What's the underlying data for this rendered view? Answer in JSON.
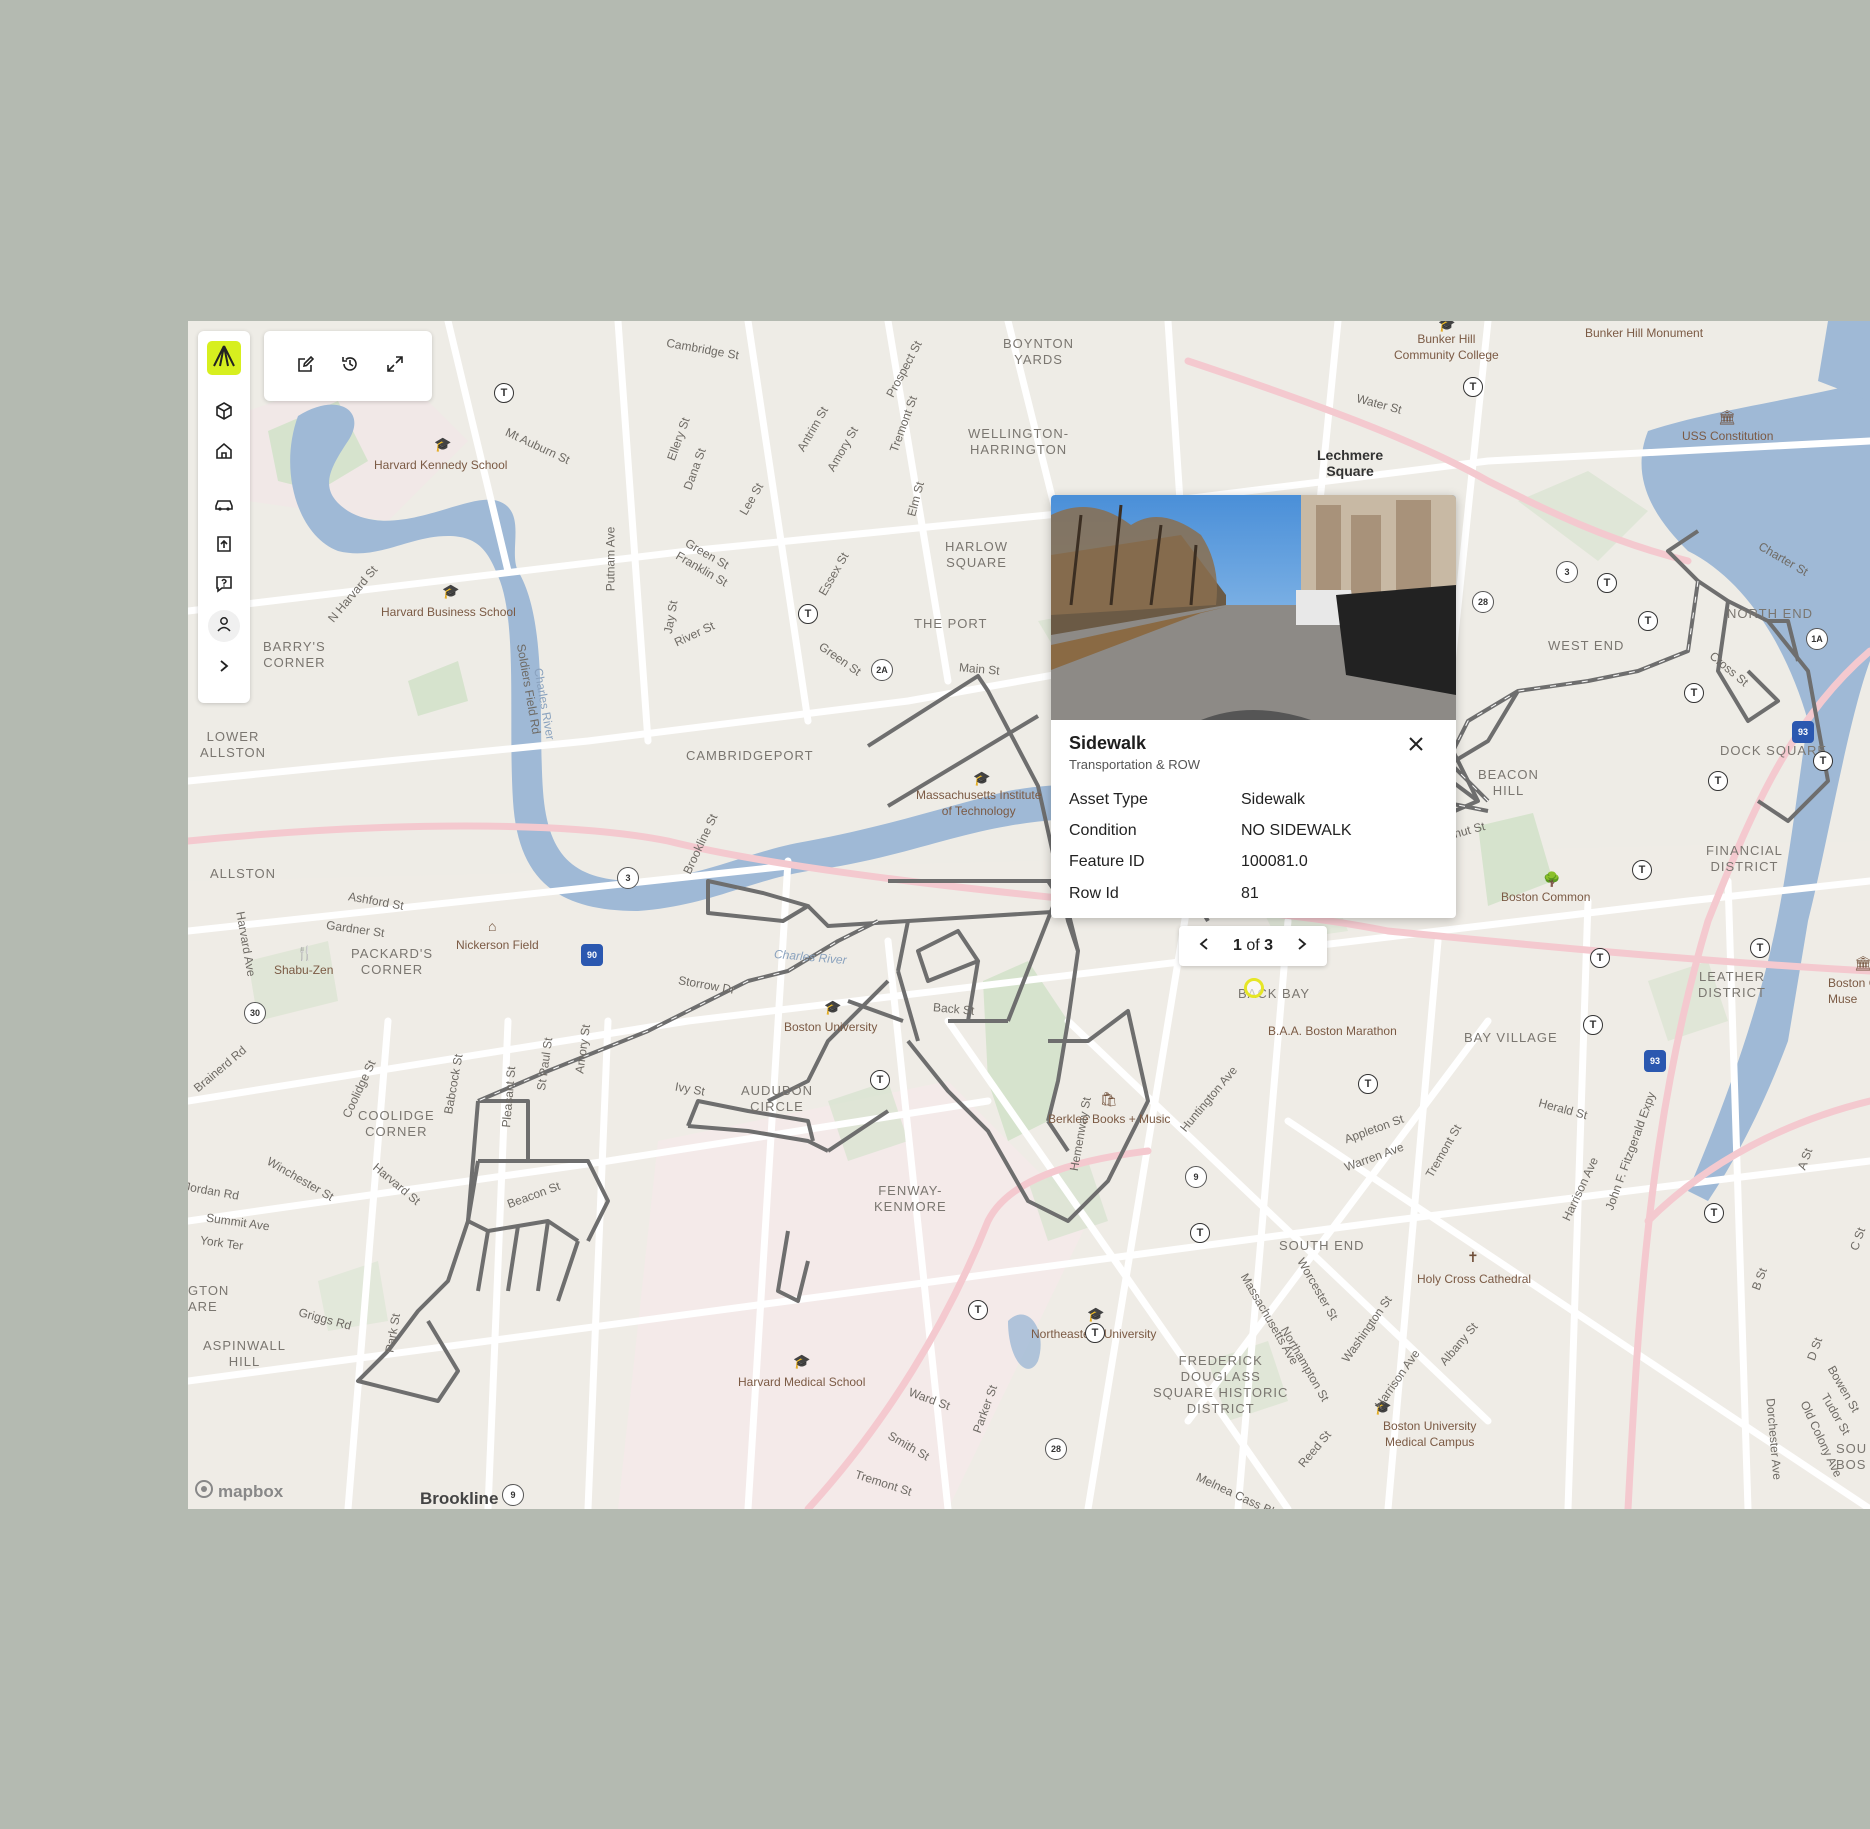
{
  "colors": {
    "accent": "#d7ef1f",
    "background": "#b4bab1",
    "water": "#9fb9d6",
    "park": "#d4e2c9",
    "asset_line": "#6e6e6e",
    "marker": "#e6e626"
  },
  "sidebar": {
    "logo_icon": "brand-logo-icon",
    "items": [
      {
        "name": "layers",
        "icon": "cube-icon"
      },
      {
        "name": "home",
        "icon": "home-icon"
      },
      {
        "name": "vehicle",
        "icon": "car-icon"
      },
      {
        "name": "upload",
        "icon": "upload-icon"
      },
      {
        "name": "feedback",
        "icon": "message-question-icon"
      },
      {
        "name": "account",
        "icon": "user-icon"
      },
      {
        "name": "expand",
        "icon": "chevron-right-icon"
      }
    ]
  },
  "toolbar": {
    "items": [
      {
        "name": "edit",
        "icon": "edit-icon"
      },
      {
        "name": "history",
        "icon": "history-icon"
      },
      {
        "name": "fullscreen",
        "icon": "expand-icon"
      }
    ]
  },
  "popup": {
    "title": "Sidewalk",
    "subtitle": "Transportation & ROW",
    "attributes": [
      {
        "key": "Asset Type",
        "value": "Sidewalk"
      },
      {
        "key": "Condition",
        "value": "NO SIDEWALK"
      },
      {
        "key": "Feature ID",
        "value": "100081.0"
      },
      {
        "key": "Row Id",
        "value": "81"
      }
    ]
  },
  "pager": {
    "current": "1",
    "separator": "of",
    "total": "3"
  },
  "attribution": "mapbox",
  "map": {
    "neighborhoods": [
      {
        "text": "BOYNTON YARDS",
        "lines": [
          "BOYNTON",
          "YARDS"
        ]
      },
      {
        "text": "WELLINGTON-HARRINGTON",
        "lines": [
          "WELLINGTON-",
          "HARRINGTON"
        ]
      },
      {
        "text": "HARLOW SQUARE",
        "lines": [
          "HARLOW",
          "SQUARE"
        ]
      },
      {
        "text": "THE PORT",
        "lines": [
          "THE PORT"
        ]
      },
      {
        "text": "CAMBRIDGEPORT",
        "lines": [
          "CAMBRIDGEPORT"
        ]
      },
      {
        "text": "BARRY'S CORNER",
        "lines": [
          "BARRY'S",
          "CORNER"
        ]
      },
      {
        "text": "LOWER ALLSTON",
        "lines": [
          "LOWER",
          "ALLSTON"
        ]
      },
      {
        "text": "ALLSTON",
        "lines": [
          "ALLSTON"
        ]
      },
      {
        "text": "PACKARD'S CORNER",
        "lines": [
          "PACKARD'S",
          "CORNER"
        ]
      },
      {
        "text": "COOLIDGE CORNER",
        "lines": [
          "COOLIDGE",
          "CORNER"
        ]
      },
      {
        "text": "AUDUBON CIRCLE",
        "lines": [
          "AUDUBON",
          "CIRCLE"
        ]
      },
      {
        "text": "FENWAY-KENMORE",
        "lines": [
          "FENWAY-",
          "KENMORE"
        ]
      },
      {
        "text": "ASPINWALL HILL",
        "lines": [
          "ASPINWALL",
          "HILL"
        ]
      },
      {
        "text": "SOUTH END",
        "lines": [
          "SOUTH END"
        ]
      },
      {
        "text": "FREDERICK DOUGLASS SQUARE HISTORIC DISTRICT",
        "lines": [
          "FREDERICK",
          "DOUGLASS",
          "SQUARE HISTORIC",
          "DISTRICT"
        ]
      },
      {
        "text": "BAY VILLAGE",
        "lines": [
          "BAY VILLAGE"
        ]
      },
      {
        "text": "LEATHER DISTRICT",
        "lines": [
          "LEATHER",
          "DISTRICT"
        ]
      },
      {
        "text": "FINANCIAL DISTRICT",
        "lines": [
          "FINANCIAL",
          "DISTRICT"
        ]
      },
      {
        "text": "BEACON HILL",
        "lines": [
          "BEACON",
          "HILL"
        ]
      },
      {
        "text": "WEST END",
        "lines": [
          "WEST END"
        ]
      },
      {
        "text": "NORTH END",
        "lines": [
          "NORTH END"
        ]
      },
      {
        "text": "DOCK SQUARE",
        "lines": [
          "DOCK SQUARE"
        ]
      },
      {
        "text": "BACK BAY",
        "lines": [
          "BACK BAY"
        ]
      },
      {
        "text": "GTON ARE",
        "lines": [
          "GTON",
          "ARE"
        ]
      },
      {
        "text": "SOU BOS",
        "lines": [
          "SOU",
          "BOS"
        ]
      }
    ],
    "places": [
      {
        "text": "Lechmere Square",
        "lines": [
          "Lechmere",
          "Square"
        ]
      },
      {
        "text": "Brookline",
        "lines": [
          "Brookline"
        ]
      }
    ],
    "pois": [
      {
        "name": "Harvard Kennedy School",
        "icon": "school-icon"
      },
      {
        "name": "Harvard Business School",
        "icon": "school-icon"
      },
      {
        "name": "Massachusetts Institute of Technology",
        "icon": "school-icon"
      },
      {
        "name": "Nickerson Field",
        "icon": "stadium-icon"
      },
      {
        "name": "Shabu-Zen",
        "icon": "restaurant-icon"
      },
      {
        "name": "Boston University",
        "icon": "school-icon"
      },
      {
        "name": "Berklee Books + Music",
        "icon": "shop-icon"
      },
      {
        "name": "Boston Common",
        "icon": "park-icon"
      },
      {
        "name": "B.A.A. Boston Marathon",
        "icon": "landmark-icon"
      },
      {
        "name": "Northeastern University",
        "icon": "school-icon"
      },
      {
        "name": "Harvard Medical School",
        "icon": "school-icon"
      },
      {
        "name": "Holy Cross Cathedral",
        "icon": "church-icon"
      },
      {
        "name": "Boston University Medical Campus",
        "icon": "school-icon"
      },
      {
        "name": "Bunker Hill Community College",
        "icon": "school-icon"
      },
      {
        "name": "Bunker Hill Monument",
        "icon": "monument-icon"
      },
      {
        "name": "USS Constitution",
        "icon": "museum-icon"
      },
      {
        "name": "Boston Children's Museum",
        "icon": "museum-icon"
      }
    ],
    "streets": [
      "Cambridge St",
      "Mt Auburn St",
      "Ellery St",
      "Dana St",
      "Lee St",
      "Antrim St",
      "Amory St",
      "Prospect St",
      "Tremont St",
      "Elm St",
      "Green St",
      "Franklin St",
      "Essex St",
      "Putnam Ave",
      "Jay St",
      "River St",
      "Green St",
      "Main St",
      "N Harvard St",
      "Soldiers Field Rd",
      "Charles River",
      "Brookline St",
      "Ashford St",
      "Gardner St",
      "Harvard Ave",
      "Storrow Dr",
      "Back St",
      "Brainerd Rd",
      "Coolidge St",
      "Babcock St",
      "Pleasant St",
      "St Paul St",
      "Amory St",
      "Ivy St",
      "Winchester St",
      "Harvard St",
      "Jordan Rd",
      "Summit Ave",
      "York Ter",
      "Beacon St",
      "Griggs Rd",
      "Park St",
      "Hemenway St",
      "Huntington Ave",
      "Appleton St",
      "Warren Ave",
      "Tremont St",
      "Herald St",
      "Harrison Ave",
      "John F. Fitzgerald Expy",
      "Massachusetts Ave",
      "Worcester St",
      "Northampton St",
      "Washington St",
      "Harrison Ave",
      "Albany St",
      "Reed St",
      "Melnea Cass Bl",
      "Ward St",
      "Parker St",
      "Smith St",
      "Tremont St",
      "Dorchester Ave",
      "Old Colony Ave",
      "A St",
      "B St",
      "C St",
      "D St",
      "Bowen St",
      "Tudor St",
      "Water St",
      "Charter St",
      "Cross St",
      "Chestnut St",
      "Charles River"
    ],
    "transit_symbol": "T",
    "route_shields": [
      "2A",
      "3",
      "28",
      "3",
      "1A",
      "90",
      "93",
      "93",
      "30",
      "9",
      "28",
      "9"
    ]
  }
}
